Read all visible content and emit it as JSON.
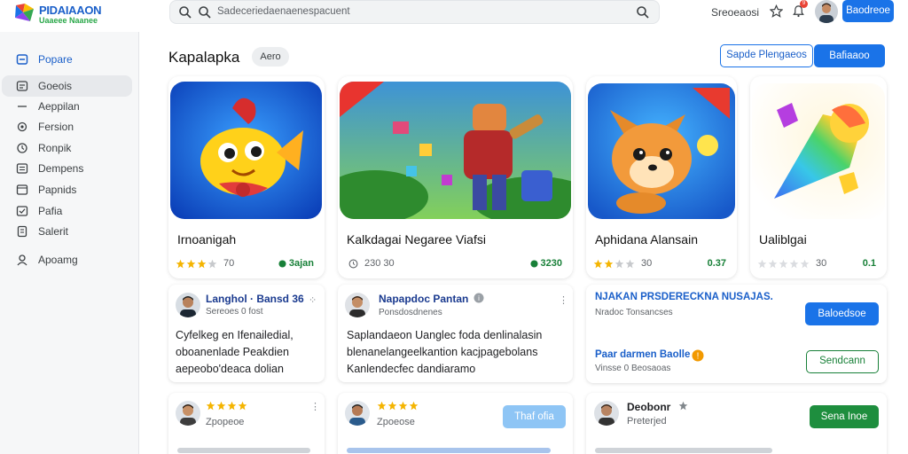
{
  "app": {
    "logo_line1": "PIDAIAAON",
    "logo_line2": "Uaaeee Naanee"
  },
  "search": {
    "placeholder": "Sadeceriedaenaenespacuent"
  },
  "header": {
    "link": "Sreoeaosi",
    "notif_count": "9",
    "account_button": "Baodreoe"
  },
  "sidebar": {
    "items": [
      {
        "label": "Popare",
        "icon": "home-icon"
      },
      {
        "label": "Goeois",
        "icon": "grid-icon"
      },
      {
        "label": "Aeppilan",
        "icon": "dash-icon"
      },
      {
        "label": "Fersion",
        "icon": "gear-icon"
      },
      {
        "label": "Ronpik",
        "icon": "clock-icon"
      },
      {
        "label": "Dempens",
        "icon": "list-icon"
      },
      {
        "label": "Papnids",
        "icon": "folder-icon"
      },
      {
        "label": "Pafia",
        "icon": "check-icon"
      },
      {
        "label": "Salerit",
        "icon": "doc-icon"
      },
      {
        "label": "Apoamg",
        "icon": "user-icon"
      }
    ]
  },
  "main": {
    "title": "Kapalapka",
    "chip": "Aero",
    "btn_outline": "Sapde Plengaeos",
    "btn_fill": "Bafiaaoo"
  },
  "apps": [
    {
      "name": "Irnoanigah",
      "rating": "70",
      "stars": 3,
      "price": "3ajan"
    },
    {
      "name": "Kalkdagai Negaree Viafsi",
      "rating": "230 30",
      "stars": 0,
      "price": "3230"
    },
    {
      "name": "Aphidana Alansain",
      "rating": "30",
      "stars": 2,
      "price": "0.37"
    },
    {
      "name": "Ualiblgai",
      "rating": "30",
      "stars": 0,
      "price": "0.1"
    }
  ],
  "reviews": [
    {
      "name": "Langhol · Bansd 36",
      "sub": "Sereoes 0 fost",
      "body": [
        "Cyfelkeg en Ifenailedial,",
        "oboanenlade Peakdien",
        "aepeobo'deaca dolian"
      ]
    },
    {
      "name": "Napapdoc Pantan",
      "sub": "Ponsdosdnenes",
      "body": [
        "Saplandaeon Uanglec foda denlinalasin",
        "blenanelangeelkantion kacjpagebolans",
        "Kanlendecfec dandiaramo"
      ]
    }
  ],
  "info_card": {
    "title": "NJAKAN PRSDERECKNA NUSAJAS.",
    "sub": "Nradoc Tonsancses",
    "button": "Baloedsoe",
    "title2": "Paar darmen Baolle",
    "sub2": "Vinsse 0 Beosaoas",
    "button2": "Sendcann"
  },
  "bottom": [
    {
      "rating": "Zpopeoe",
      "stars": 4
    },
    {
      "rating": "Zpoeose",
      "stars": 4,
      "button": "Thaf ofia"
    },
    {
      "name": "Deobonr",
      "sub": "Preterjed",
      "button": "Sena Inoe"
    }
  ]
}
